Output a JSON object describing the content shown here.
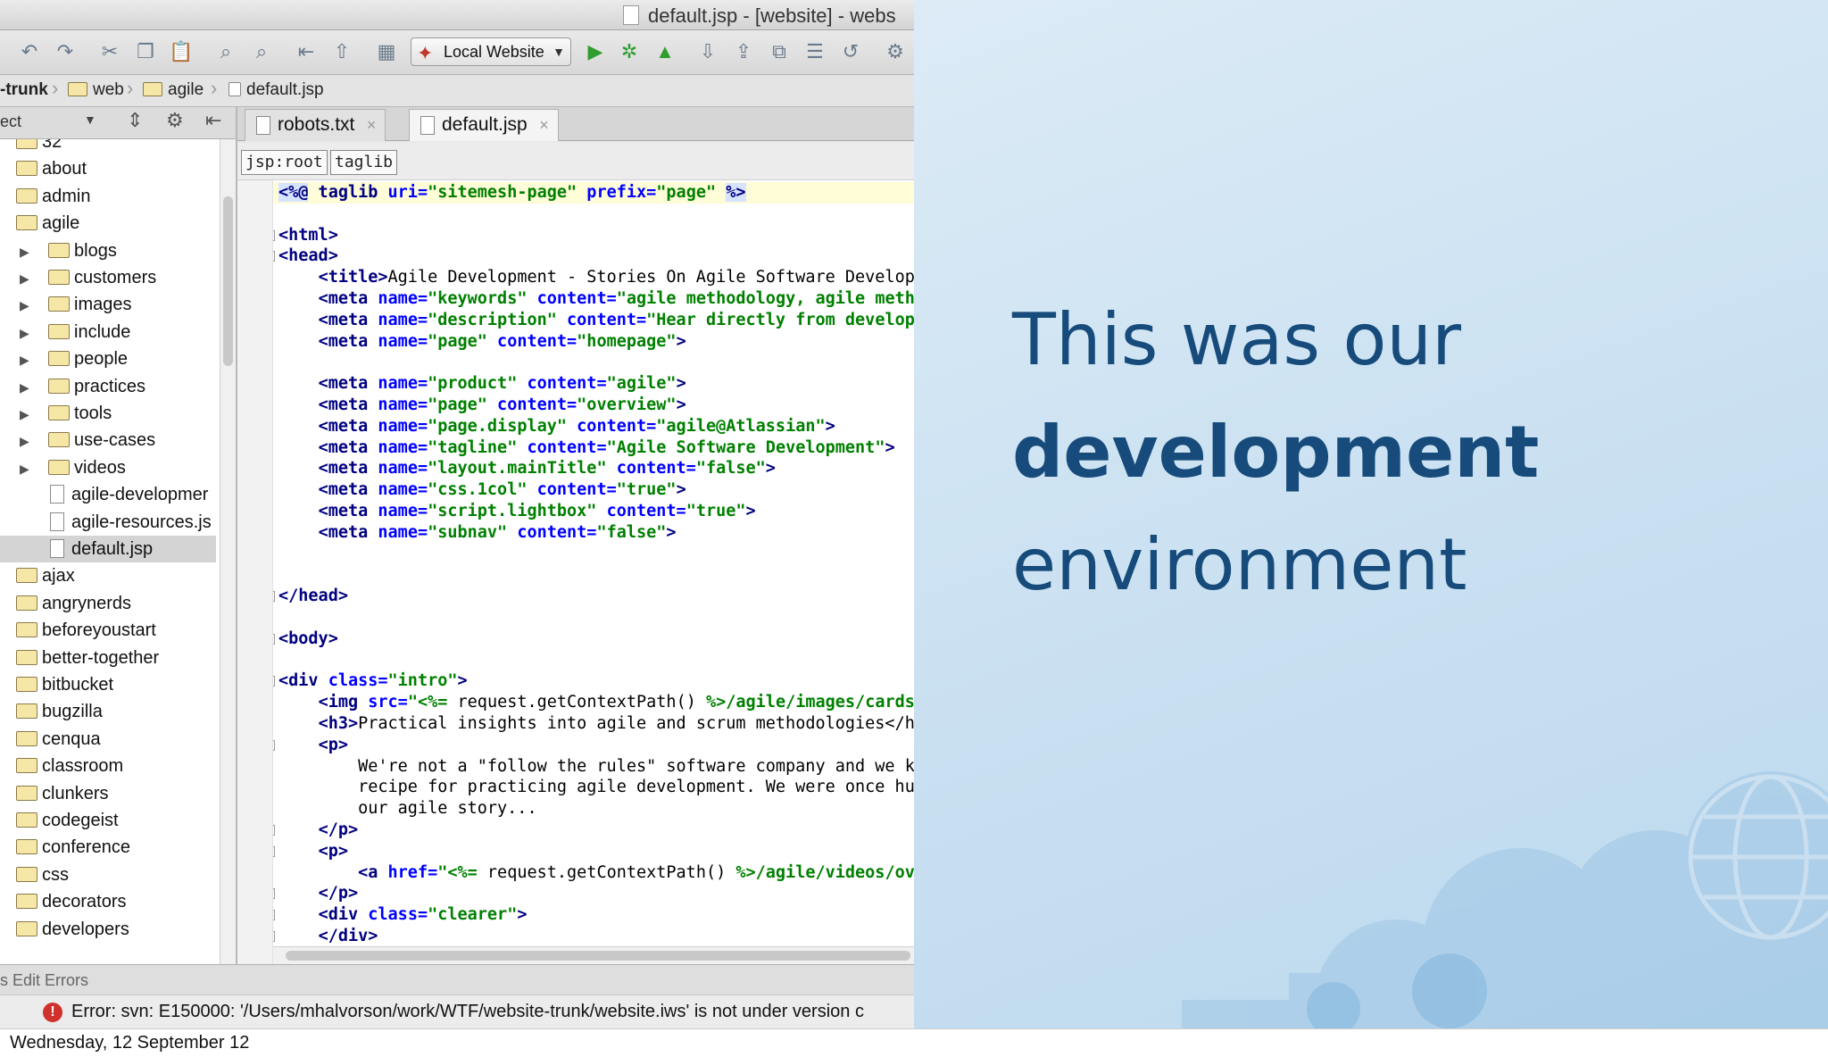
{
  "window": {
    "title": "default.jsp - [website] - webs"
  },
  "toolbar": {
    "run_config": "Local Website"
  },
  "breadcrumb": [
    "-trunk",
    "web",
    "agile",
    "default.jsp"
  ],
  "project_panel": {
    "header": "ect"
  },
  "tree": [
    {
      "label": "32",
      "kind": "folder"
    },
    {
      "label": "about",
      "kind": "folder"
    },
    {
      "label": "admin",
      "kind": "folder"
    },
    {
      "label": "agile",
      "kind": "folder-open"
    },
    {
      "label": "blogs",
      "kind": "subfolder"
    },
    {
      "label": "customers",
      "kind": "subfolder"
    },
    {
      "label": "images",
      "kind": "subfolder"
    },
    {
      "label": "include",
      "kind": "subfolder"
    },
    {
      "label": "people",
      "kind": "subfolder"
    },
    {
      "label": "practices",
      "kind": "subfolder"
    },
    {
      "label": "tools",
      "kind": "subfolder"
    },
    {
      "label": "use-cases",
      "kind": "subfolder"
    },
    {
      "label": "videos",
      "kind": "subfolder"
    },
    {
      "label": "agile-developmer",
      "kind": "file"
    },
    {
      "label": "agile-resources.js",
      "kind": "file"
    },
    {
      "label": "default.jsp",
      "kind": "file-selected"
    },
    {
      "label": "ajax",
      "kind": "folder"
    },
    {
      "label": "angrynerds",
      "kind": "folder"
    },
    {
      "label": "beforeyoustart",
      "kind": "folder"
    },
    {
      "label": "better-together",
      "kind": "folder"
    },
    {
      "label": "bitbucket",
      "kind": "folder"
    },
    {
      "label": "bugzilla",
      "kind": "folder"
    },
    {
      "label": "cenqua",
      "kind": "folder"
    },
    {
      "label": "classroom",
      "kind": "folder"
    },
    {
      "label": "clunkers",
      "kind": "folder"
    },
    {
      "label": "codegeist",
      "kind": "folder"
    },
    {
      "label": "conference",
      "kind": "folder"
    },
    {
      "label": "css",
      "kind": "folder"
    },
    {
      "label": "decorators",
      "kind": "folder"
    },
    {
      "label": "developers",
      "kind": "folder"
    }
  ],
  "tabs": [
    {
      "label": "robots.txt",
      "active": false
    },
    {
      "label": "default.jsp",
      "active": true
    }
  ],
  "xml_breadcrumb": [
    "jsp:root",
    "taglib"
  ],
  "code_lines": [
    {
      "row": 0,
      "indent": 0,
      "parts": [
        [
          "dir",
          "<%@"
        ],
        [
          "tag",
          " taglib"
        ],
        [
          "attr",
          " uri="
        ],
        [
          "val",
          "\"sitemesh-page\""
        ],
        [
          "attr",
          " prefix="
        ],
        [
          "val",
          "\"page\""
        ],
        [
          "plain",
          " "
        ],
        [
          "dir",
          "%>"
        ]
      ],
      "highlight": true
    },
    {
      "row": 2,
      "indent": 0,
      "parts": [
        [
          "tag",
          "<html>"
        ]
      ]
    },
    {
      "row": 3,
      "indent": 0,
      "parts": [
        [
          "tag",
          "<head>"
        ]
      ]
    },
    {
      "row": 4,
      "indent": 4,
      "parts": [
        [
          "tag",
          "<title>"
        ],
        [
          "plain",
          "Agile Development - Stories On Agile Software Develop"
        ]
      ]
    },
    {
      "row": 5,
      "indent": 4,
      "parts": [
        [
          "tag",
          "<meta"
        ],
        [
          "attr",
          " name="
        ],
        [
          "val",
          "\"keywords\""
        ],
        [
          "attr",
          " content="
        ],
        [
          "val",
          "\"agile methodology, agile meth"
        ]
      ]
    },
    {
      "row": 6,
      "indent": 4,
      "parts": [
        [
          "tag",
          "<meta"
        ],
        [
          "attr",
          " name="
        ],
        [
          "val",
          "\"description\""
        ],
        [
          "attr",
          " content="
        ],
        [
          "val",
          "\"Hear directly from develop"
        ]
      ]
    },
    {
      "row": 7,
      "indent": 4,
      "parts": [
        [
          "tag",
          "<meta"
        ],
        [
          "attr",
          " name="
        ],
        [
          "val",
          "\"page\""
        ],
        [
          "attr",
          " content="
        ],
        [
          "val",
          "\"homepage\""
        ],
        [
          "tag",
          ">"
        ]
      ]
    },
    {
      "row": 9,
      "indent": 4,
      "parts": [
        [
          "tag",
          "<meta"
        ],
        [
          "attr",
          " name="
        ],
        [
          "val",
          "\"product\""
        ],
        [
          "attr",
          " content="
        ],
        [
          "val",
          "\"agile\""
        ],
        [
          "tag",
          ">"
        ]
      ]
    },
    {
      "row": 10,
      "indent": 4,
      "parts": [
        [
          "tag",
          "<meta"
        ],
        [
          "attr",
          " name="
        ],
        [
          "val",
          "\"page\""
        ],
        [
          "attr",
          " content="
        ],
        [
          "val",
          "\"overview\""
        ],
        [
          "tag",
          ">"
        ]
      ]
    },
    {
      "row": 11,
      "indent": 4,
      "parts": [
        [
          "tag",
          "<meta"
        ],
        [
          "attr",
          " name="
        ],
        [
          "val",
          "\"page.display\""
        ],
        [
          "attr",
          " content="
        ],
        [
          "val",
          "\"agile@Atlassian\""
        ],
        [
          "tag",
          ">"
        ]
      ]
    },
    {
      "row": 12,
      "indent": 4,
      "parts": [
        [
          "tag",
          "<meta"
        ],
        [
          "attr",
          " name="
        ],
        [
          "val",
          "\"tagline\""
        ],
        [
          "attr",
          " content="
        ],
        [
          "val",
          "\"Agile Software Development\""
        ],
        [
          "tag",
          ">"
        ]
      ]
    },
    {
      "row": 13,
      "indent": 4,
      "parts": [
        [
          "tag",
          "<meta"
        ],
        [
          "attr",
          " name="
        ],
        [
          "val",
          "\"layout.mainTitle\""
        ],
        [
          "attr",
          " content="
        ],
        [
          "val",
          "\"false\""
        ],
        [
          "tag",
          ">"
        ]
      ]
    },
    {
      "row": 14,
      "indent": 4,
      "parts": [
        [
          "tag",
          "<meta"
        ],
        [
          "attr",
          " name="
        ],
        [
          "val",
          "\"css.1col\""
        ],
        [
          "attr",
          " content="
        ],
        [
          "val",
          "\"true\""
        ],
        [
          "tag",
          ">"
        ]
      ]
    },
    {
      "row": 15,
      "indent": 4,
      "parts": [
        [
          "tag",
          "<meta"
        ],
        [
          "attr",
          " name="
        ],
        [
          "val",
          "\"script.lightbox\""
        ],
        [
          "attr",
          " content="
        ],
        [
          "val",
          "\"true\""
        ],
        [
          "tag",
          ">"
        ]
      ]
    },
    {
      "row": 16,
      "indent": 4,
      "parts": [
        [
          "tag",
          "<meta"
        ],
        [
          "attr",
          " name="
        ],
        [
          "val",
          "\"subnav\""
        ],
        [
          "attr",
          " content="
        ],
        [
          "val",
          "\"false\""
        ],
        [
          "tag",
          ">"
        ]
      ]
    },
    {
      "row": 19,
      "indent": 0,
      "parts": [
        [
          "tag",
          "</head>"
        ]
      ]
    },
    {
      "row": 21,
      "indent": 0,
      "parts": [
        [
          "tag",
          "<body>"
        ]
      ]
    },
    {
      "row": 23,
      "indent": 0,
      "parts": [
        [
          "tag",
          "<div"
        ],
        [
          "attr",
          " class="
        ],
        [
          "val",
          "\"intro\""
        ],
        [
          "tag",
          ">"
        ]
      ]
    },
    {
      "row": 24,
      "indent": 4,
      "parts": [
        [
          "tag",
          "<img"
        ],
        [
          "attr",
          " src="
        ],
        [
          "val",
          "\"<%= "
        ],
        [
          "plain",
          "request.getContextPath() "
        ],
        [
          "val",
          "%>/agile/images/cards"
        ]
      ]
    },
    {
      "row": 25,
      "indent": 4,
      "parts": [
        [
          "tag",
          "<h3>"
        ],
        [
          "plain",
          "Practical insights into agile and scrum methodologies</h"
        ]
      ]
    },
    {
      "row": 26,
      "indent": 4,
      "parts": [
        [
          "tag",
          "<p>"
        ]
      ]
    },
    {
      "row": 27,
      "indent": 8,
      "parts": [
        [
          "plain",
          "We're not a \"follow the rules\" software company and we k"
        ]
      ]
    },
    {
      "row": 28,
      "indent": 8,
      "parts": [
        [
          "plain",
          "recipe for practicing agile development. We were once hu"
        ]
      ]
    },
    {
      "row": 29,
      "indent": 8,
      "parts": [
        [
          "plain",
          "our agile story..."
        ]
      ]
    },
    {
      "row": 30,
      "indent": 4,
      "parts": [
        [
          "tag",
          "</p>"
        ]
      ]
    },
    {
      "row": 31,
      "indent": 4,
      "parts": [
        [
          "tag",
          "<p>"
        ]
      ]
    },
    {
      "row": 32,
      "indent": 8,
      "parts": [
        [
          "tag",
          "<a"
        ],
        [
          "attr",
          " href="
        ],
        [
          "val",
          "\"<%= "
        ],
        [
          "plain",
          "request.getContextPath() "
        ],
        [
          "val",
          "%>/agile/videos/ov"
        ]
      ]
    },
    {
      "row": 33,
      "indent": 4,
      "parts": [
        [
          "tag",
          "</p>"
        ]
      ]
    },
    {
      "row": 34,
      "indent": 4,
      "parts": [
        [
          "tag",
          "<div"
        ],
        [
          "attr",
          " class="
        ],
        [
          "val",
          "\"clearer\""
        ],
        [
          "tag",
          ">"
        ]
      ]
    },
    {
      "row": 35,
      "indent": 4,
      "parts": [
        [
          "tag",
          "</div>"
        ]
      ]
    }
  ],
  "bottom_panel": {
    "header": "s Edit Errors"
  },
  "error": {
    "text": "Error: svn: E150000: '/Users/mhalvorson/work/WTF/website-trunk/website.iws' is not under version c"
  },
  "slide": {
    "line1": "This was our",
    "line2": "development",
    "line3": "environment"
  },
  "footer": {
    "date": "Wednesday, 12 September 12"
  },
  "colors": {
    "slide_text": "#164b7b",
    "slide_bg": "#c9e0f1",
    "error_icon": "#d0312d"
  }
}
